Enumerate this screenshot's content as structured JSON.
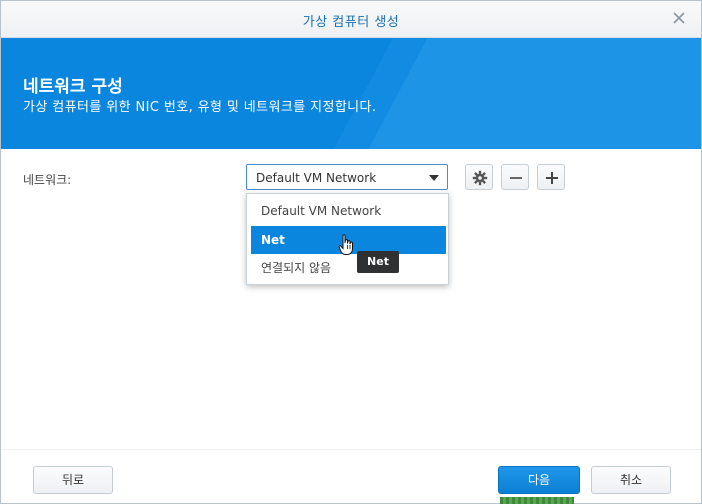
{
  "dialog": {
    "title": "가상 컴퓨터 생성",
    "close_icon": "close-icon"
  },
  "header": {
    "title": "네트워크 구성",
    "subtitle": "가상 컴퓨터를 위한 NIC 번호, 유형 및 네트워크를 지정합니다."
  },
  "network": {
    "label": "네트워크:",
    "selected": "Default VM Network",
    "options": [
      "Default VM Network",
      "Net",
      "연결되지 않음"
    ],
    "highlighted_option": "Net",
    "tooltip": "Net"
  },
  "toolbar_icons": [
    "gear-icon",
    "minus-icon",
    "plus-icon"
  ],
  "footer": {
    "back_label": "뒤로",
    "next_label": "다음",
    "cancel_label": "취소"
  },
  "colors": {
    "accent": "#0b86df",
    "title_text": "#1d6fb3",
    "tooltip_bg": "#2f3133"
  }
}
